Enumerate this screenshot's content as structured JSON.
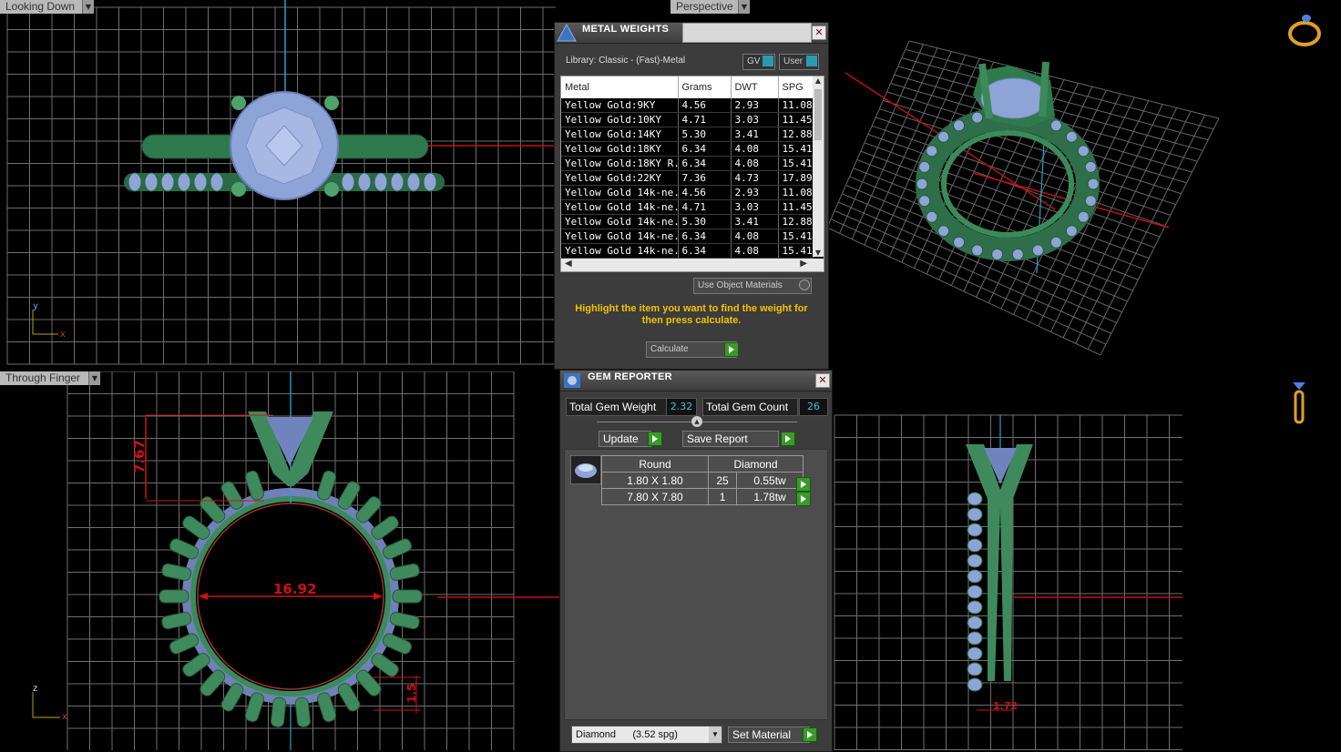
{
  "viewports": {
    "top_left": {
      "label": "Looking Down"
    },
    "top_right": {
      "label": "Perspective"
    },
    "bottom_left": {
      "label": "Through Finger"
    },
    "bottom_right": {
      "label": ""
    }
  },
  "axes": {
    "x": "x",
    "y": "y",
    "z": "z"
  },
  "dimensions": {
    "height": "7.67",
    "inner_diameter": "16.92",
    "shank_thickness": "1.5",
    "shank_width": "1.72"
  },
  "metal_weights": {
    "title": "METAL WEIGHTS",
    "library": "Library: Classic - (Fast)-Metal",
    "gv_label": "GV",
    "user_label": "User",
    "columns": [
      "Metal",
      "Grams",
      "DWT",
      "SPG"
    ],
    "rows": [
      [
        "Yellow Gold:9KY",
        "4.56",
        "2.93",
        "11.08"
      ],
      [
        "Yellow Gold:10KY",
        "4.71",
        "3.03",
        "11.45"
      ],
      [
        "Yellow Gold:14KY",
        "5.30",
        "3.41",
        "12.88"
      ],
      [
        "Yellow Gold:18KY",
        "6.34",
        "4.08",
        "15.41"
      ],
      [
        "Yellow Gold:18KY R...",
        "6.34",
        "4.08",
        "15.41"
      ],
      [
        "Yellow Gold:22KY",
        "7.36",
        "4.73",
        "17.89"
      ],
      [
        "Yellow Gold 14k-ne...",
        "4.56",
        "2.93",
        "11.08"
      ],
      [
        "Yellow Gold 14k-ne...",
        "4.71",
        "3.03",
        "11.45"
      ],
      [
        "Yellow Gold 14k-ne...",
        "5.30",
        "3.41",
        "12.88"
      ],
      [
        "Yellow Gold 14k-ne...",
        "6.34",
        "4.08",
        "15.41"
      ],
      [
        "Yellow Gold 14k-ne...",
        "6.34",
        "4.08",
        "15.41"
      ]
    ],
    "use_object_materials": "Use Object Materials",
    "hint": "Highlight the item you want to find the weight for then press calculate.",
    "calculate": "Calculate"
  },
  "gem_reporter": {
    "title": "GEM REPORTER",
    "total_weight_label": "Total Gem Weight",
    "total_weight": "2.32",
    "total_count_label": "Total Gem Count",
    "total_count": "26",
    "update": "Update",
    "save_report": "Save Report",
    "shape": "Round",
    "material": "Diamond",
    "rows": [
      {
        "size": "1.80 X 1.80",
        "count": "25",
        "weight": "0.55tw"
      },
      {
        "size": "7.80 X 7.80",
        "count": "1",
        "weight": "1.78tw"
      }
    ],
    "material_select": "Diamond      (3.52 spg)",
    "set_material": "Set Material"
  },
  "colors": {
    "ring": "#3f8a5c",
    "gem": "#8fa4d6",
    "dimension": "#d01010",
    "accent": "#f2c200"
  }
}
